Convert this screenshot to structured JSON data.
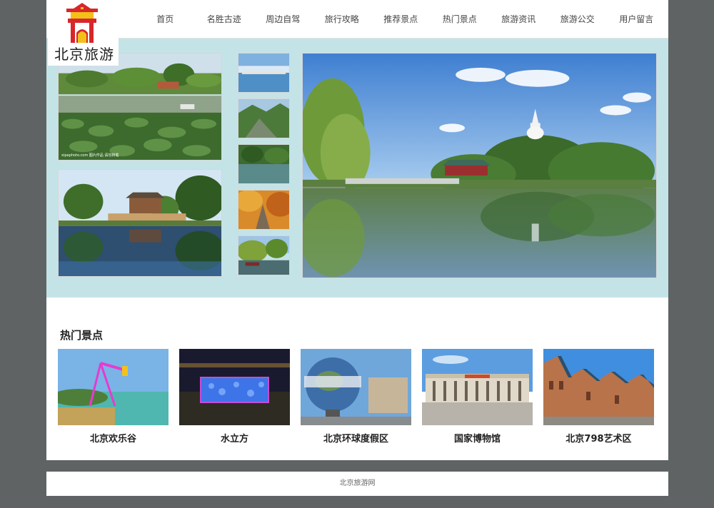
{
  "site": {
    "logo_text": "北京旅游"
  },
  "nav": [
    {
      "label": "首页"
    },
    {
      "label": "名胜古迹"
    },
    {
      "label": "周边自驾"
    },
    {
      "label": "旅行攻略"
    },
    {
      "label": "推荐景点"
    },
    {
      "label": "热门景点"
    },
    {
      "label": "旅游资讯"
    },
    {
      "label": "旅游公交"
    },
    {
      "label": "用户留言"
    }
  ],
  "banner": {
    "photo_credit": "xipaphoto.com 图片作品 请勿转载"
  },
  "hot": {
    "title": "热门景点",
    "items": [
      {
        "name": "北京欢乐谷"
      },
      {
        "name": "水立方"
      },
      {
        "name": "北京环球度假区"
      },
      {
        "name": "国家博物馆"
      },
      {
        "name": "北京798艺术区"
      }
    ]
  },
  "footer": {
    "text": "北京旅游网"
  },
  "colors": {
    "page_bg": "#5f6364",
    "banner_bg": "#c4e3e7",
    "logo_red": "#d8262a",
    "logo_yellow": "#f3c01a"
  }
}
